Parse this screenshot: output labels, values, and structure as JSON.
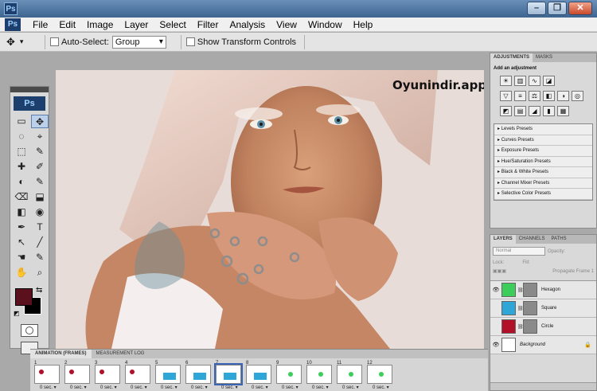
{
  "app": {
    "badge": "Ps"
  },
  "window_controls": {
    "minimize": "–",
    "restore": "❐",
    "close": "✕"
  },
  "menu": [
    "File",
    "Edit",
    "Image",
    "Layer",
    "Select",
    "Filter",
    "Analysis",
    "View",
    "Window",
    "Help"
  ],
  "options": {
    "tool_icon": "move-tool-icon",
    "auto_select_label": "Auto-Select:",
    "auto_select_value": "Group",
    "transform_label": "Show Transform Controls"
  },
  "tools": {
    "badge": "Ps",
    "icons": [
      "▭",
      "✥",
      "◌",
      "⌖",
      "⬚",
      "✎",
      "✚",
      "✐",
      "◐",
      "✎",
      "⌫",
      "⬓",
      "◧",
      "◉",
      "✒",
      "T",
      "↖",
      "╱",
      "☚",
      "✎",
      "✋",
      "⌕"
    ],
    "fg_color": "#5a111d",
    "bg_color": "#000000"
  },
  "canvas": {
    "watermark": "Oyunindir.app"
  },
  "animation": {
    "tabs": [
      "ANIMATION (FRAMES)",
      "MEASUREMENT LOG"
    ],
    "frames": [
      {
        "n": "1",
        "shape": "circle",
        "delay": "0 sec."
      },
      {
        "n": "2",
        "shape": "circle",
        "delay": "0 sec."
      },
      {
        "n": "3",
        "shape": "circle",
        "delay": "0 sec."
      },
      {
        "n": "4",
        "shape": "circle",
        "delay": "0 sec."
      },
      {
        "n": "5",
        "shape": "square",
        "delay": "0 sec."
      },
      {
        "n": "6",
        "shape": "square",
        "delay": "0 sec."
      },
      {
        "n": "7",
        "shape": "square",
        "delay": "0 sec."
      },
      {
        "n": "8",
        "shape": "square",
        "delay": "0 sec."
      },
      {
        "n": "9",
        "shape": "hexagon",
        "delay": "0 sec."
      },
      {
        "n": "10",
        "shape": "hexagon",
        "delay": "0 sec."
      },
      {
        "n": "11",
        "shape": "hexagon",
        "delay": "0 sec."
      },
      {
        "n": "12",
        "shape": "hexagon",
        "delay": "0 sec."
      }
    ],
    "selected_frame": "7"
  },
  "adjustments": {
    "tabs": [
      "ADJUSTMENTS",
      "MASKS"
    ],
    "title": "Add an adjustment",
    "presets": [
      "Levels Presets",
      "Curves Presets",
      "Exposure Presets",
      "Hue/Saturation Presets",
      "Black & White Presets",
      "Channel Mixer Presets",
      "Selective Color Presets"
    ]
  },
  "layers": {
    "tabs": [
      "LAYERS",
      "CHANNELS",
      "PATHS"
    ],
    "blend_mode": "Normal",
    "opacity_label": "Opacity:",
    "lock_label": "Lock:",
    "fill_label": "Fill:",
    "propagate_label": "Propagate Frame 1",
    "items": [
      {
        "name": "Hexagon",
        "color": "#3ccd5b",
        "visible": true
      },
      {
        "name": "Square",
        "color": "#2ea6d7",
        "visible": false
      },
      {
        "name": "Circle",
        "color": "#b20f28",
        "visible": false
      },
      {
        "name": "Background",
        "color": "#ffffff",
        "visible": true
      }
    ]
  }
}
